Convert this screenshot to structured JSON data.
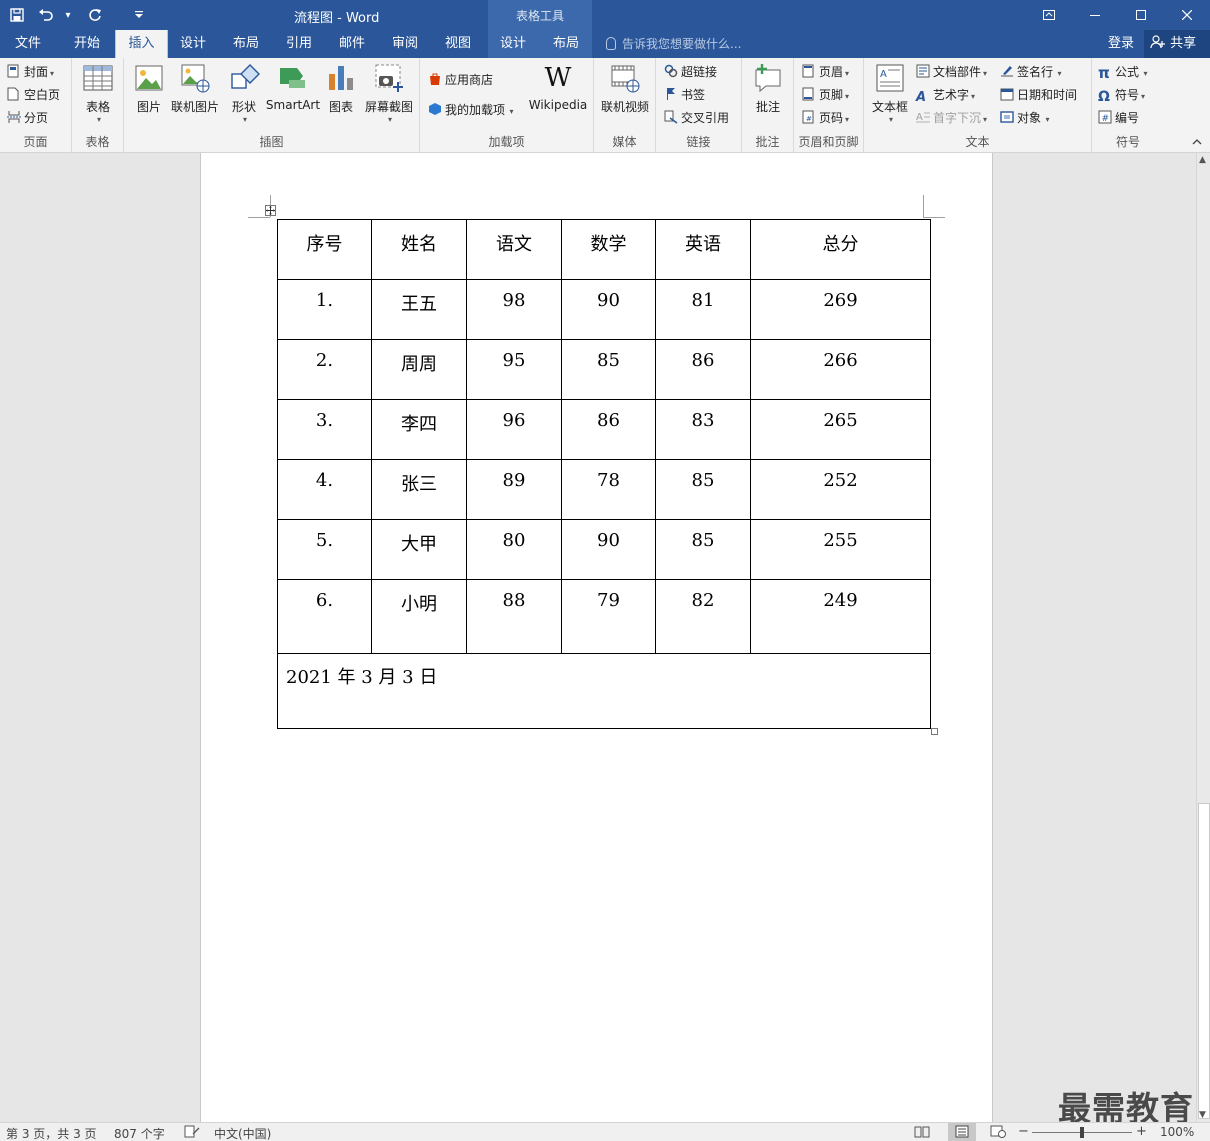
{
  "app": {
    "title": "流程图 - Word",
    "context_title": "表格工具",
    "qat": {
      "save_icon": "save-icon",
      "undo_icon": "undo-icon",
      "redo_icon": "redo-icon",
      "customize": "▾"
    },
    "window_controls": {
      "restore_ribbon": "▣",
      "minimize": "—",
      "maximize": "☐",
      "close": "✕"
    }
  },
  "tabs": [
    {
      "label": "文件"
    },
    {
      "label": "开始"
    },
    {
      "label": "插入"
    },
    {
      "label": "设计"
    },
    {
      "label": "布局"
    },
    {
      "label": "引用"
    },
    {
      "label": "邮件"
    },
    {
      "label": "审阅"
    },
    {
      "label": "视图"
    },
    {
      "label": "设计"
    },
    {
      "label": "布局"
    }
  ],
  "active_tab": "插入",
  "tell_me": "告诉我您想要做什么...",
  "signin": "登录",
  "share": "共享",
  "ribbon": {
    "pages": {
      "label": "页面",
      "cover": "封面",
      "blank": "空白页",
      "break": "分页"
    },
    "tables": {
      "label": "表格",
      "table": "表格"
    },
    "illustrations": {
      "label": "插图",
      "picture": "图片",
      "online_picture": "联机图片",
      "shapes": "形状",
      "smartart": "SmartArt",
      "chart": "图表",
      "screenshot": "屏幕截图"
    },
    "addins": {
      "label": "加载项",
      "store": "应用商店",
      "my_addins": "我的加载项",
      "wikipedia": "Wikipedia"
    },
    "media": {
      "label": "媒体",
      "online_video": "联机视频"
    },
    "links": {
      "label": "链接",
      "hyperlink": "超链接",
      "bookmark": "书签",
      "cross_ref": "交叉引用"
    },
    "comments": {
      "label": "批注",
      "comment": "批注"
    },
    "header_footer": {
      "label": "页眉和页脚",
      "header": "页眉",
      "footer": "页脚",
      "page_number": "页码"
    },
    "text": {
      "label": "文本",
      "textbox": "文本框",
      "quick_parts": "文档部件",
      "wordart": "艺术字",
      "dropcap": "首字下沉",
      "signature": "签名行",
      "datetime": "日期和时间",
      "object": "对象"
    },
    "symbols": {
      "label": "符号",
      "equation": "公式",
      "symbol": "符号",
      "numbering": "编号"
    }
  },
  "table": {
    "headers": [
      "序号",
      "姓名",
      "语文",
      "数学",
      "英语",
      "总分"
    ],
    "rows": [
      [
        "1.",
        "王五",
        "98",
        "90",
        "81",
        "269"
      ],
      [
        "2.",
        "周周",
        "95",
        "85",
        "86",
        "266"
      ],
      [
        "3.",
        "李四",
        "96",
        "86",
        "83",
        "265"
      ],
      [
        "4.",
        "张三",
        "89",
        "78",
        "85",
        "252"
      ],
      [
        "5.",
        "大甲",
        "80",
        "90",
        "85",
        "255"
      ],
      [
        "6.",
        "小明",
        "88",
        "79",
        "82",
        "249"
      ]
    ],
    "date": "2021 年 3 月 3 日"
  },
  "watermark": "最需教育",
  "status": {
    "page": "第 3 页，共 3 页",
    "words": "807 个字",
    "language": "中文(中国)",
    "zoom": "100%"
  }
}
